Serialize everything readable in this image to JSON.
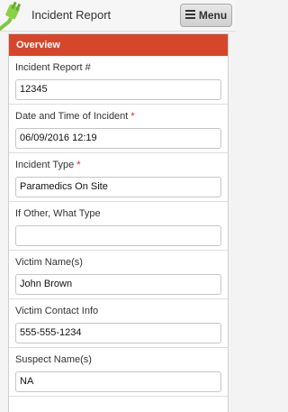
{
  "header": {
    "title": "Incident Report",
    "menu_label": "Menu",
    "logo_icon": "plug-icon",
    "accent": "#d6462b"
  },
  "form": {
    "section_title": "Overview",
    "fields": [
      {
        "label": "Incident Report #",
        "required": false,
        "value": "12345"
      },
      {
        "label": "Date and Time of Incident",
        "required": true,
        "value": "06/09/2016 12:19"
      },
      {
        "label": "Incident Type",
        "required": true,
        "value": "Paramedics On Site"
      },
      {
        "label": "If Other, What Type",
        "required": false,
        "value": ""
      },
      {
        "label": "Victim Name(s)",
        "required": false,
        "value": "John Brown"
      },
      {
        "label": "Victim Contact Info",
        "required": false,
        "value": "555-555-1234"
      },
      {
        "label": "Suspect Name(s)",
        "required": false,
        "value": "NA"
      }
    ],
    "required_marker": "*"
  }
}
